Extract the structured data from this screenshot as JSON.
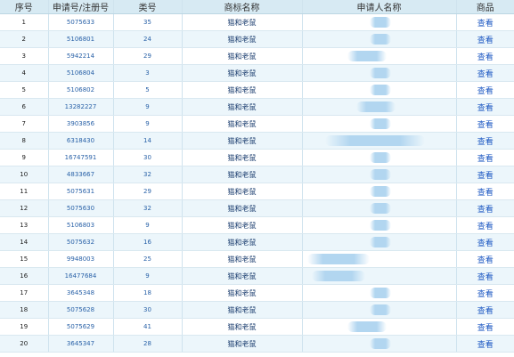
{
  "table": {
    "headers": {
      "index": "序号",
      "app_no": "申请号/注册号",
      "class_no": "类号",
      "mark_name": "商标名称",
      "applicant": "申请人名称",
      "goods": "商品"
    },
    "rows": [
      {
        "index": "1",
        "app_no": "5075633",
        "class_no": "35",
        "mark_name": "猫和老鼠",
        "goods": "查看"
      },
      {
        "index": "2",
        "app_no": "5106801",
        "class_no": "24",
        "mark_name": "猫和老鼠",
        "goods": "查看"
      },
      {
        "index": "3",
        "app_no": "5942214",
        "class_no": "29",
        "mark_name": "猫和老鼠",
        "goods": "查看"
      },
      {
        "index": "4",
        "app_no": "5106804",
        "class_no": "3",
        "mark_name": "猫和老鼠",
        "goods": "查看"
      },
      {
        "index": "5",
        "app_no": "5106802",
        "class_no": "5",
        "mark_name": "猫和老鼠",
        "goods": "查看"
      },
      {
        "index": "6",
        "app_no": "13282227",
        "class_no": "9",
        "mark_name": "猫和老鼠",
        "goods": "查看"
      },
      {
        "index": "7",
        "app_no": "3903856",
        "class_no": "9",
        "mark_name": "猫和老鼠",
        "goods": "查看"
      },
      {
        "index": "8",
        "app_no": "6318430",
        "class_no": "14",
        "mark_name": "猫和老鼠",
        "goods": "查看"
      },
      {
        "index": "9",
        "app_no": "16747591",
        "class_no": "30",
        "mark_name": "猫和老鼠",
        "goods": "查看"
      },
      {
        "index": "10",
        "app_no": "4833667",
        "class_no": "32",
        "mark_name": "猫和老鼠",
        "goods": "查看"
      },
      {
        "index": "11",
        "app_no": "5075631",
        "class_no": "29",
        "mark_name": "猫和老鼠",
        "goods": "查看"
      },
      {
        "index": "12",
        "app_no": "5075630",
        "class_no": "32",
        "mark_name": "猫和老鼠",
        "goods": "查看"
      },
      {
        "index": "13",
        "app_no": "5106803",
        "class_no": "9",
        "mark_name": "猫和老鼠",
        "goods": "查看"
      },
      {
        "index": "14",
        "app_no": "5075632",
        "class_no": "16",
        "mark_name": "猫和老鼠",
        "goods": "查看"
      },
      {
        "index": "15",
        "app_no": "9948003",
        "class_no": "25",
        "mark_name": "猫和老鼠",
        "goods": "查看"
      },
      {
        "index": "16",
        "app_no": "16477684",
        "class_no": "9",
        "mark_name": "猫和老鼠",
        "goods": "查看"
      },
      {
        "index": "17",
        "app_no": "3645348",
        "class_no": "18",
        "mark_name": "猫和老鼠",
        "goods": "查看"
      },
      {
        "index": "18",
        "app_no": "5075628",
        "class_no": "30",
        "mark_name": "猫和老鼠",
        "goods": "查看"
      },
      {
        "index": "19",
        "app_no": "5075629",
        "class_no": "41",
        "mark_name": "猫和老鼠",
        "goods": "查看"
      },
      {
        "index": "20",
        "app_no": "3645347",
        "class_no": "28",
        "mark_name": "猫和老鼠",
        "goods": "查看"
      }
    ]
  }
}
